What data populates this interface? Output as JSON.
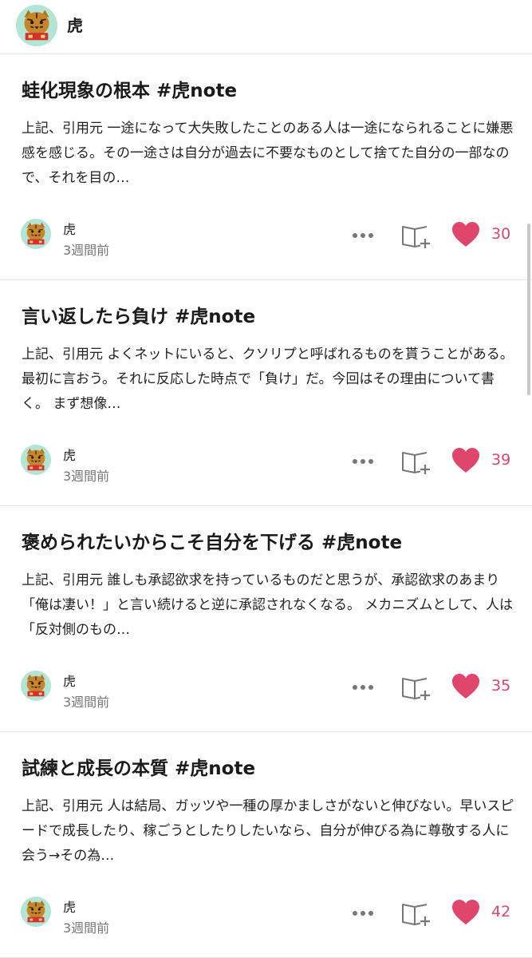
{
  "header": {
    "creator_name": "虎"
  },
  "colors": {
    "accent": "#e0456b",
    "avatar_bg": "#b3e5d6"
  },
  "articles": [
    {
      "title": "蛙化現象の根本 #虎note",
      "excerpt": "上記、引用元 一途になって大失敗したことのある人は一途になられることに嫌悪感を感じる。その一途さは自分が過去に不要なものとして捨てた自分の一部なので、それを目の…",
      "author": "虎",
      "time": "3週間前",
      "likes": "30"
    },
    {
      "title": "言い返したら負け #虎note",
      "excerpt": "上記、引用元 よくネットにいると、クソリプと呼ばれるものを貰うことがある。 最初に言おう。それに反応した時点で「負け」だ。今回はその理由について書く。 まず想像…",
      "author": "虎",
      "time": "3週間前",
      "likes": "39"
    },
    {
      "title": "褒められたいからこそ自分を下げる #虎note",
      "excerpt": "上記、引用元 誰しも承認欲求を持っているものだと思うが、承認欲求のあまり「俺は凄い！」と言い続けると逆に承認されなくなる。 メカニズムとして、人は「反対側のもの…",
      "author": "虎",
      "time": "3週間前",
      "likes": "35"
    },
    {
      "title": "試練と成長の本質 #虎note",
      "excerpt": "上記、引用元 人は結局、ガッツや一種の厚かましさがないと伸びない。早いスピードで成長したり、稼ごうとしたりしたいなら、自分が伸びる為に尊敬する人に会う→その為…",
      "author": "虎",
      "time": "3週間前",
      "likes": "42"
    }
  ]
}
